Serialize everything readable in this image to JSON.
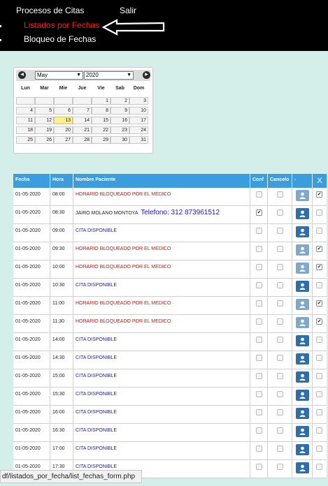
{
  "menu": {
    "procesos": "Procesos de Citas",
    "salir": "Salir",
    "listados": "Listados por Fechas",
    "bloqueo": "Bloqueo de Fechas"
  },
  "calendar": {
    "month": "May",
    "year": "2020",
    "prev_icon": "chevron-left-icon",
    "next_icon": "chevron-right-icon",
    "weekdays": [
      "Lun",
      "Mar",
      "Mie",
      "Jue",
      "Vie",
      "Sab",
      "Dom"
    ],
    "weeks": [
      [
        "",
        "",
        "",
        "",
        "1",
        "2",
        "3"
      ],
      [
        "4",
        "5",
        "6",
        "7",
        "8",
        "9",
        "10"
      ],
      [
        "11",
        "12",
        "13",
        "14",
        "15",
        "16",
        "17"
      ],
      [
        "18",
        "19",
        "20",
        "21",
        "22",
        "23",
        "24"
      ],
      [
        "25",
        "26",
        "27",
        "28",
        "29",
        "30",
        "31"
      ]
    ],
    "selected_day": "13"
  },
  "table": {
    "headers": {
      "fecha": "Fecha",
      "hora": "Hora",
      "nombre": "Nombre Paciente",
      "conf": "Conf",
      "cancelo": "Cancelo",
      "dash": "-",
      "x": "X"
    },
    "rows": [
      {
        "fecha": "01-05-2020",
        "hora": "08:00",
        "nombre": "HORARIO BLOQUEADO POR EL MEDICO",
        "telefono": "",
        "kind": "blocked",
        "conf": false,
        "cancelo": false,
        "x": true
      },
      {
        "fecha": "01-05-2020",
        "hora": "08:30",
        "nombre": "JAIRO MOLANO MONTOYA",
        "telefono": "Telefono: 312 873961512",
        "kind": "patient",
        "conf": true,
        "cancelo": false,
        "x": false
      },
      {
        "fecha": "01-05-2020",
        "hora": "09:00",
        "nombre": "CITA DISPONIBLE",
        "telefono": "",
        "kind": "available",
        "conf": false,
        "cancelo": false,
        "x": false
      },
      {
        "fecha": "01-05-2020",
        "hora": "09:30",
        "nombre": "HORARIO BLOQUEADO POR EL MEDICO",
        "telefono": "",
        "kind": "blocked",
        "conf": false,
        "cancelo": false,
        "x": true
      },
      {
        "fecha": "01-05-2020",
        "hora": "10:00",
        "nombre": "HORARIO BLOQUEADO POR EL MEDICO",
        "telefono": "",
        "kind": "blocked",
        "conf": false,
        "cancelo": false,
        "x": true
      },
      {
        "fecha": "01-05-2020",
        "hora": "10:30",
        "nombre": "CITA DISPONIBLE",
        "telefono": "",
        "kind": "available",
        "conf": false,
        "cancelo": false,
        "x": false
      },
      {
        "fecha": "01-05-2020",
        "hora": "11:00",
        "nombre": "HORARIO BLOQUEADO POR EL MEDICO",
        "telefono": "",
        "kind": "blocked",
        "conf": false,
        "cancelo": false,
        "x": true
      },
      {
        "fecha": "01-05-2020",
        "hora": "11:30",
        "nombre": "HORARIO BLOQUEADO POR EL MEDICO",
        "telefono": "",
        "kind": "blocked",
        "conf": false,
        "cancelo": false,
        "x": true
      },
      {
        "fecha": "01-05-2020",
        "hora": "14:00",
        "nombre": "CITA DISPONIBLE",
        "telefono": "",
        "kind": "available",
        "conf": false,
        "cancelo": false,
        "x": false
      },
      {
        "fecha": "01-05-2020",
        "hora": "14:30",
        "nombre": "CITA DISPONIBLE",
        "telefono": "",
        "kind": "available",
        "conf": false,
        "cancelo": false,
        "x": false
      },
      {
        "fecha": "01-05-2020",
        "hora": "15:00",
        "nombre": "CITA DISPONIBLE",
        "telefono": "",
        "kind": "available",
        "conf": false,
        "cancelo": false,
        "x": false
      },
      {
        "fecha": "01-05-2020",
        "hora": "15:30",
        "nombre": "CITA DISPONIBLE",
        "telefono": "",
        "kind": "available",
        "conf": false,
        "cancelo": false,
        "x": false
      },
      {
        "fecha": "01-05-2020",
        "hora": "16:00",
        "nombre": "CITA DISPONIBLE",
        "telefono": "",
        "kind": "available",
        "conf": false,
        "cancelo": false,
        "x": false
      },
      {
        "fecha": "01-05-2020",
        "hora": "16:30",
        "nombre": "CITA DISPONIBLE",
        "telefono": "",
        "kind": "available",
        "conf": false,
        "cancelo": false,
        "x": false
      },
      {
        "fecha": "01-05-2020",
        "hora": "17:00",
        "nombre": "CITA DISPONIBLE",
        "telefono": "",
        "kind": "available",
        "conf": false,
        "cancelo": false,
        "x": false
      },
      {
        "fecha": "01-05-2020",
        "hora": "17:30",
        "nombre": "CITA DISPONIBLE",
        "telefono": "",
        "kind": "available",
        "conf": false,
        "cancelo": false,
        "x": false
      }
    ]
  },
  "statusbar": {
    "url": "df/listados_por_fecha/list_fechas_form.php"
  },
  "colors": {
    "menu_bg": "#000000",
    "page_bg": "#d4efe9",
    "header_blue": "#3c9ddc",
    "blocked_red": "#e01010",
    "available_blue": "#1a1acd",
    "button_blue": "#2a6fb0",
    "today_yellow": "#fbf28a"
  }
}
